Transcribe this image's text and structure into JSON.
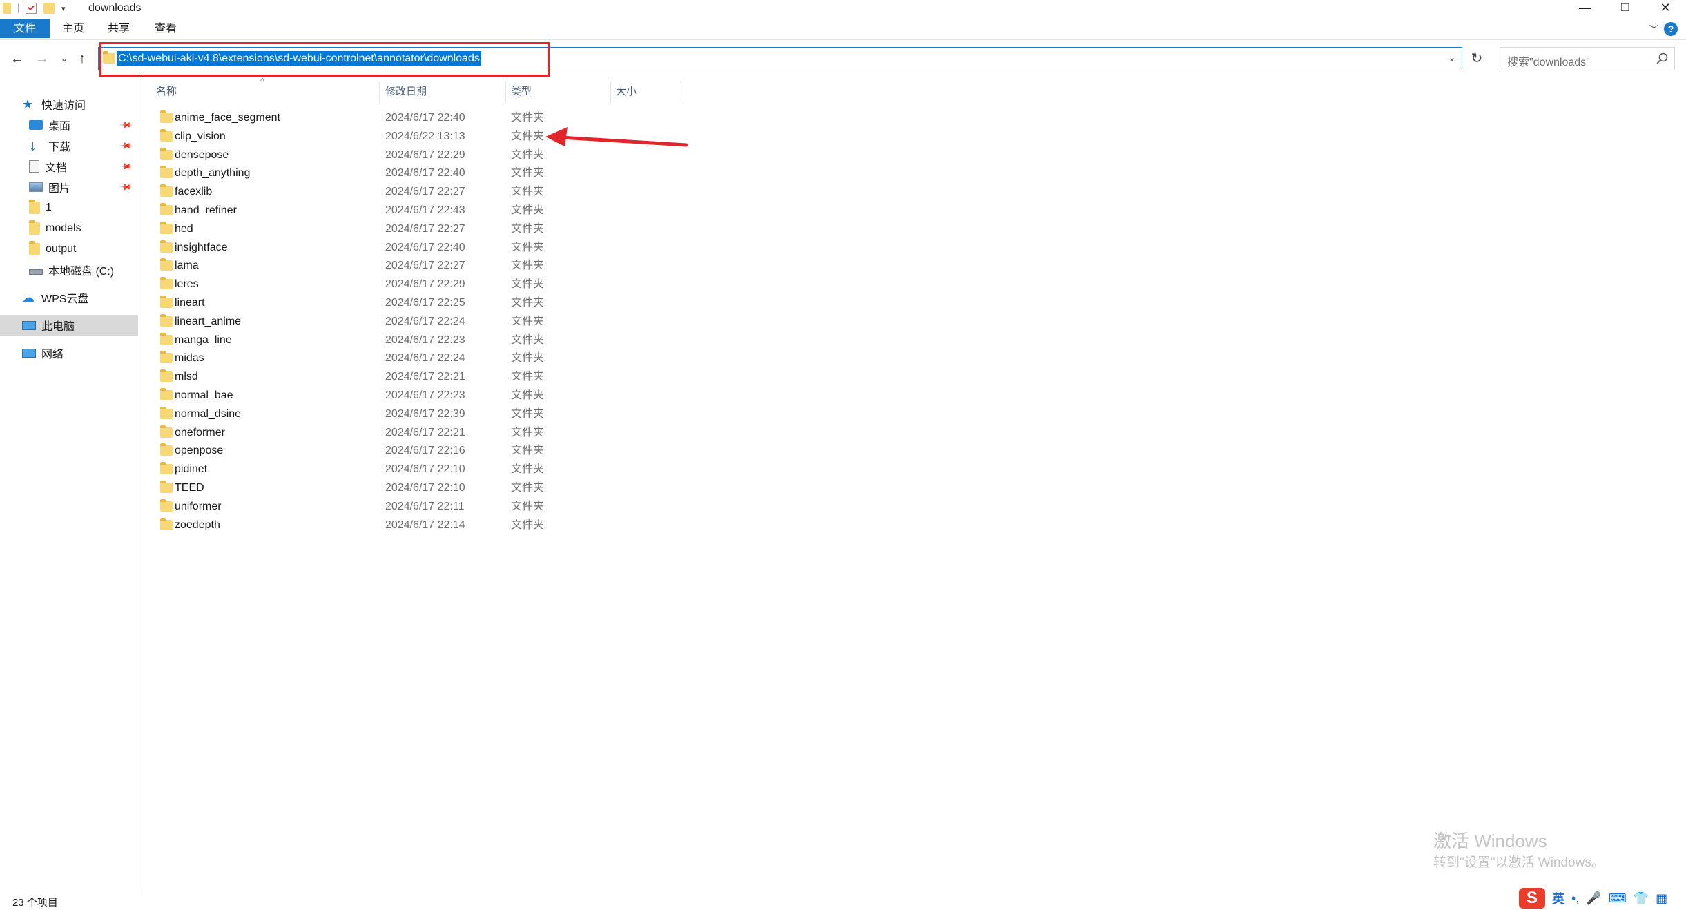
{
  "window": {
    "title": "downloads",
    "controls": {
      "minimize": "—",
      "restore": "❐",
      "close": "✕"
    }
  },
  "ribbon": {
    "tabs": [
      "文件",
      "主页",
      "共享",
      "查看"
    ]
  },
  "address_bar": {
    "path": "C:\\sd-webui-aki-v4.8\\extensions\\sd-webui-controlnet\\annotator\\downloads",
    "search_placeholder": "搜索\"downloads\""
  },
  "nav_pane": {
    "quick_access": "快速访问",
    "items": [
      {
        "label": "桌面",
        "pinned": true,
        "icon": "desktop-icon"
      },
      {
        "label": "下载",
        "pinned": true,
        "icon": "download-icon"
      },
      {
        "label": "文档",
        "pinned": true,
        "icon": "document-icon"
      },
      {
        "label": "图片",
        "pinned": true,
        "icon": "picture-icon"
      },
      {
        "label": "1",
        "pinned": false,
        "icon": "folder-icon"
      },
      {
        "label": "models",
        "pinned": false,
        "icon": "folder-icon"
      },
      {
        "label": "output",
        "pinned": false,
        "icon": "folder-icon"
      },
      {
        "label": "本地磁盘 (C:)",
        "pinned": false,
        "icon": "drive-icon"
      }
    ],
    "wps": "WPS云盘",
    "this_pc": "此电脑",
    "network": "网络"
  },
  "columns": {
    "name": "名称",
    "date": "修改日期",
    "type": "类型",
    "size": "大小"
  },
  "files": [
    {
      "name": "anime_face_segment",
      "date": "2024/6/17 22:40",
      "type": "文件夹"
    },
    {
      "name": "clip_vision",
      "date": "2024/6/22 13:13",
      "type": "文件夹"
    },
    {
      "name": "densepose",
      "date": "2024/6/17 22:29",
      "type": "文件夹"
    },
    {
      "name": "depth_anything",
      "date": "2024/6/17 22:40",
      "type": "文件夹"
    },
    {
      "name": "facexlib",
      "date": "2024/6/17 22:27",
      "type": "文件夹"
    },
    {
      "name": "hand_refiner",
      "date": "2024/6/17 22:43",
      "type": "文件夹"
    },
    {
      "name": "hed",
      "date": "2024/6/17 22:27",
      "type": "文件夹"
    },
    {
      "name": "insightface",
      "date": "2024/6/17 22:40",
      "type": "文件夹"
    },
    {
      "name": "lama",
      "date": "2024/6/17 22:27",
      "type": "文件夹"
    },
    {
      "name": "leres",
      "date": "2024/6/17 22:29",
      "type": "文件夹"
    },
    {
      "name": "lineart",
      "date": "2024/6/17 22:25",
      "type": "文件夹"
    },
    {
      "name": "lineart_anime",
      "date": "2024/6/17 22:24",
      "type": "文件夹"
    },
    {
      "name": "manga_line",
      "date": "2024/6/17 22:23",
      "type": "文件夹"
    },
    {
      "name": "midas",
      "date": "2024/6/17 22:24",
      "type": "文件夹"
    },
    {
      "name": "mlsd",
      "date": "2024/6/17 22:21",
      "type": "文件夹"
    },
    {
      "name": "normal_bae",
      "date": "2024/6/17 22:23",
      "type": "文件夹"
    },
    {
      "name": "normal_dsine",
      "date": "2024/6/17 22:39",
      "type": "文件夹"
    },
    {
      "name": "oneformer",
      "date": "2024/6/17 22:21",
      "type": "文件夹"
    },
    {
      "name": "openpose",
      "date": "2024/6/17 22:16",
      "type": "文件夹"
    },
    {
      "name": "pidinet",
      "date": "2024/6/17 22:10",
      "type": "文件夹"
    },
    {
      "name": "TEED",
      "date": "2024/6/17 22:10",
      "type": "文件夹"
    },
    {
      "name": "uniformer",
      "date": "2024/6/17 22:11",
      "type": "文件夹"
    },
    {
      "name": "zoedepth",
      "date": "2024/6/17 22:14",
      "type": "文件夹"
    }
  ],
  "status_bar": {
    "count": "23 个项目"
  },
  "watermark": {
    "line1": "激活 Windows",
    "line2": "转到\"设置\"以激活 Windows。"
  },
  "tray": {
    "ime": "S",
    "lang": "英"
  },
  "colors": {
    "accent": "#1979ca",
    "selection": "#0078d7",
    "annotation": "#e0262b",
    "folder": "#f8d775"
  }
}
